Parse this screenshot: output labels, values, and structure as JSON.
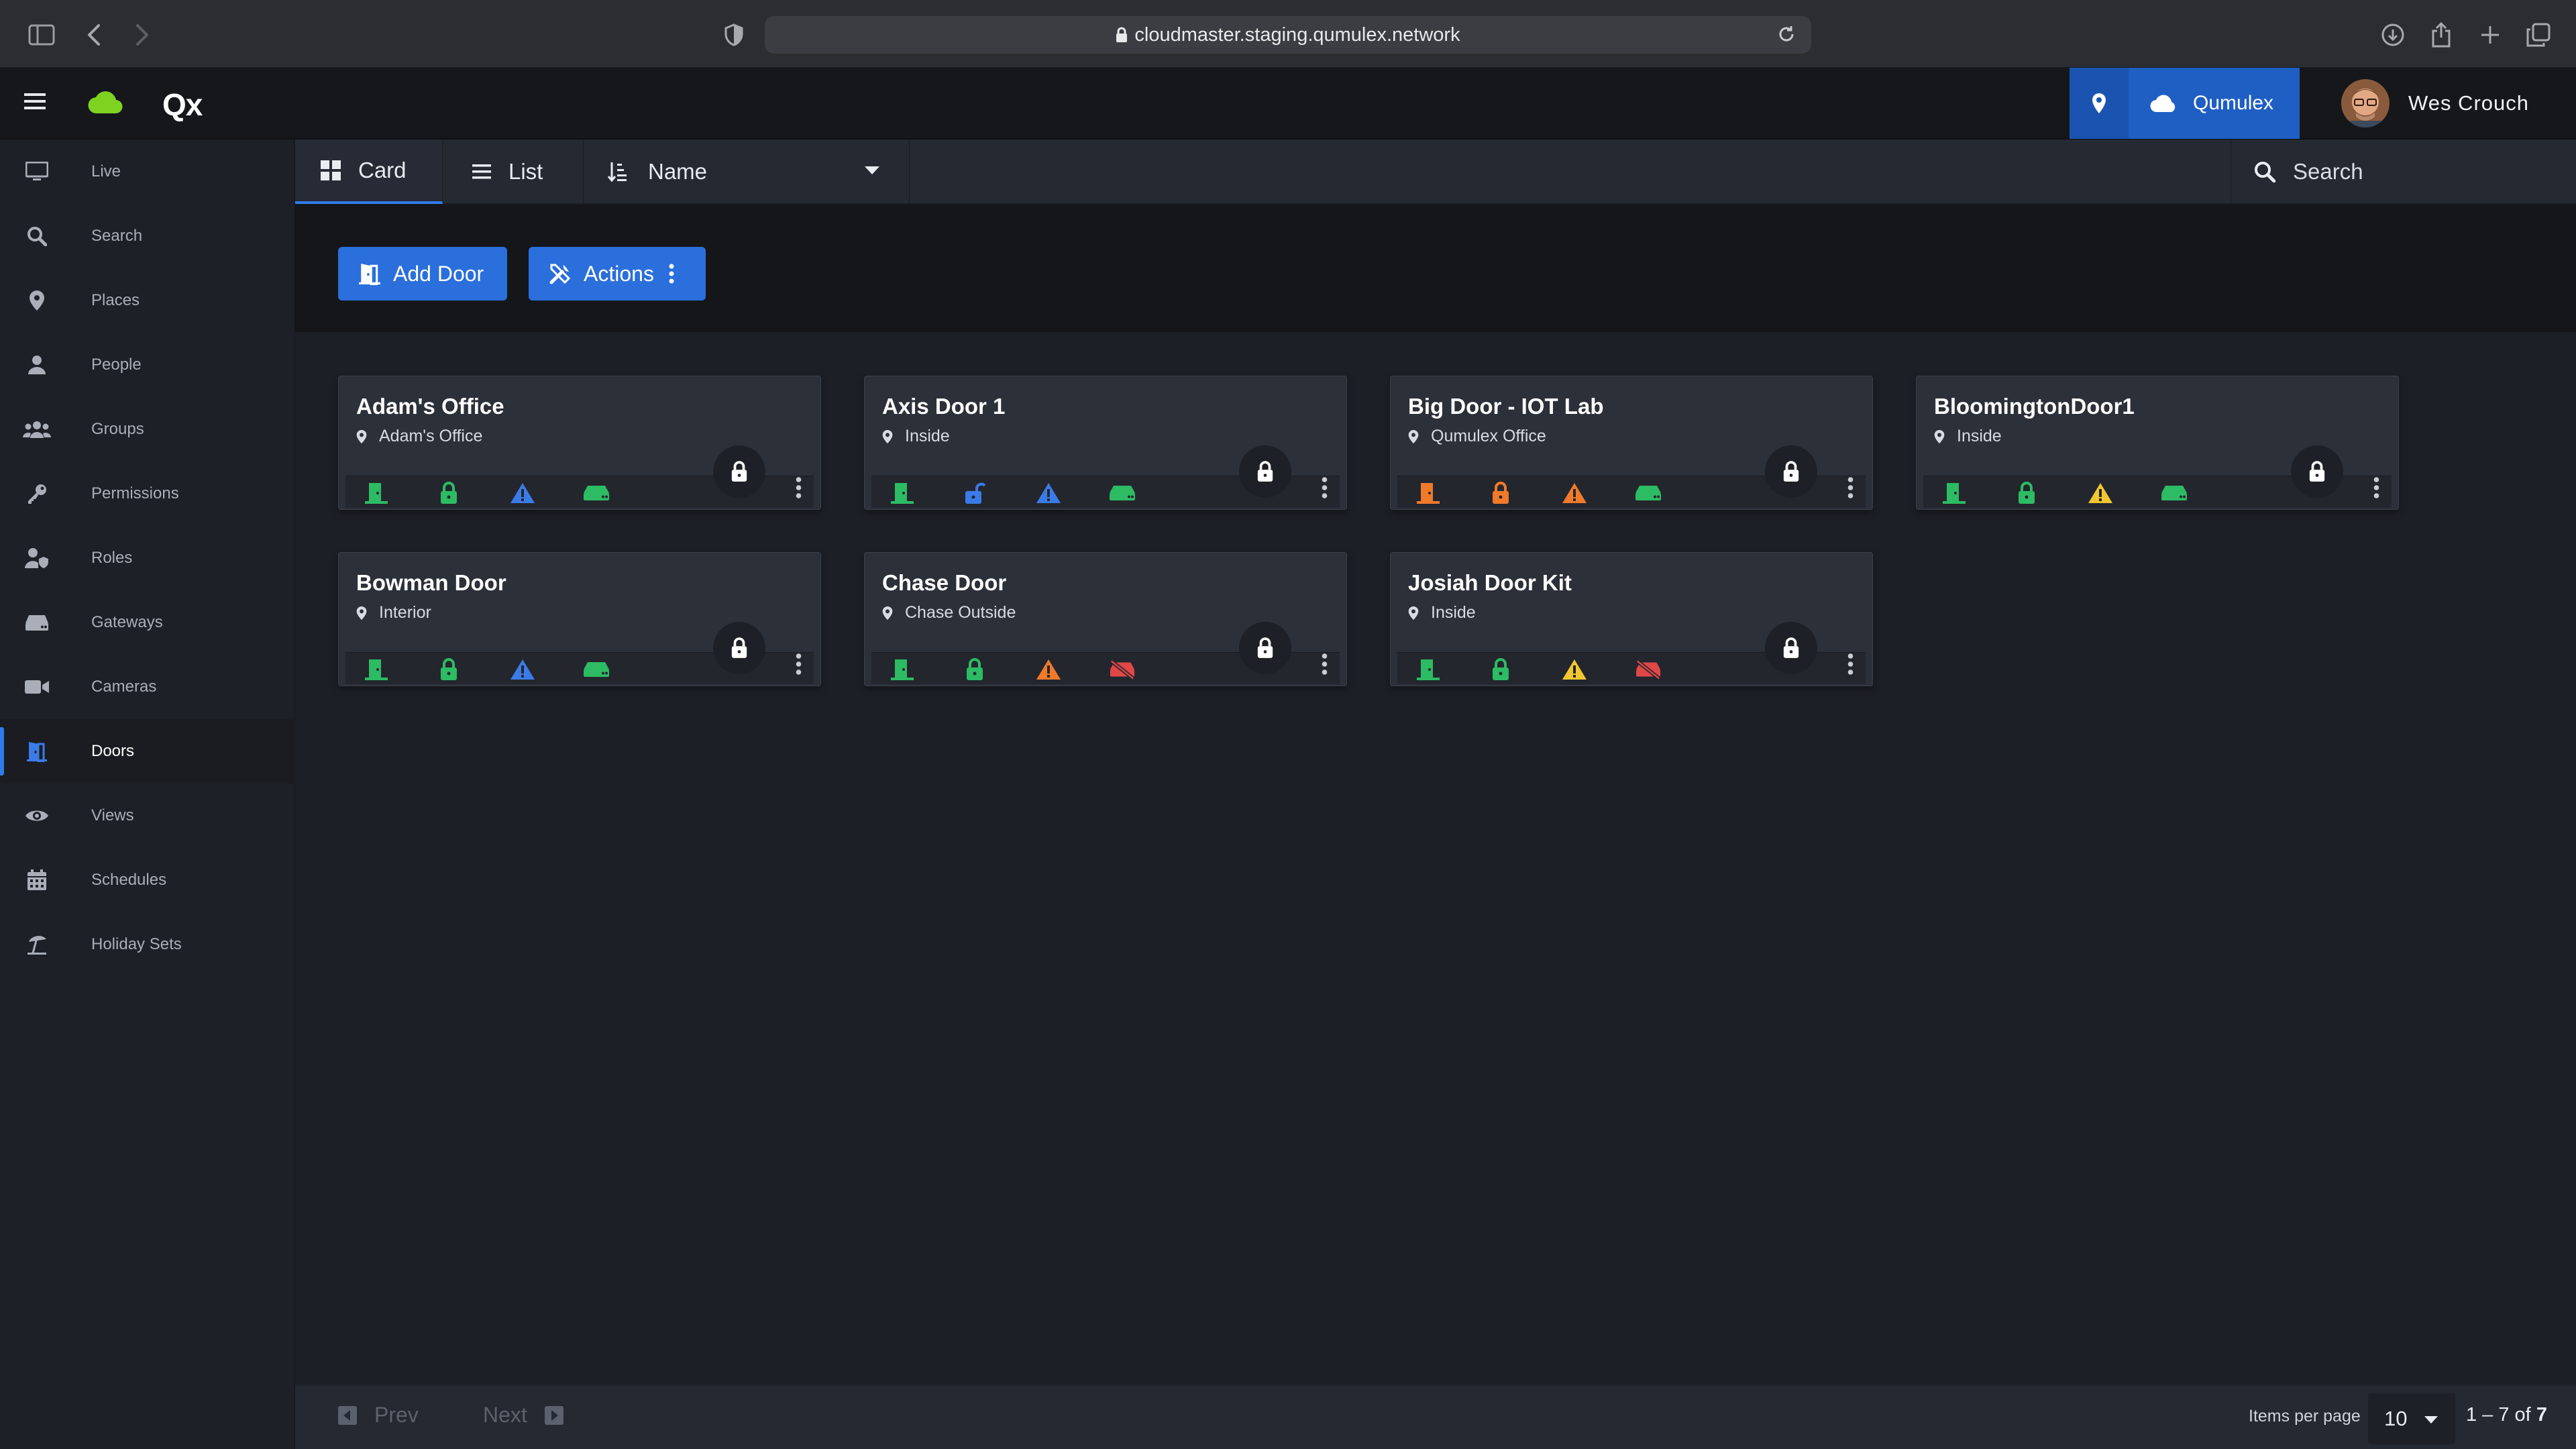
{
  "browser": {
    "url": "cloudmaster.staging.qumulex.network"
  },
  "header": {
    "brand": "Qx",
    "account_label": "Qumulex",
    "user_name": "Wes Crouch"
  },
  "colors": {
    "accent": "#2a6fdb",
    "ok": "#2dbb63",
    "info": "#3b7be8",
    "warn_orange": "#f07a2a",
    "warn_yellow": "#f2c631",
    "error": "#e24747"
  },
  "sidebar": {
    "items": [
      {
        "label": "Live",
        "icon": "monitor-icon"
      },
      {
        "label": "Search",
        "icon": "search-icon"
      },
      {
        "label": "Places",
        "icon": "map-pin-icon"
      },
      {
        "label": "People",
        "icon": "person-icon"
      },
      {
        "label": "Groups",
        "icon": "group-icon"
      },
      {
        "label": "Permissions",
        "icon": "key-icon"
      },
      {
        "label": "Roles",
        "icon": "user-shield-icon"
      },
      {
        "label": "Gateways",
        "icon": "server-icon"
      },
      {
        "label": "Cameras",
        "icon": "camera-icon"
      },
      {
        "label": "Doors",
        "icon": "door-icon",
        "active": true
      },
      {
        "label": "Views",
        "icon": "eye-icon"
      },
      {
        "label": "Schedules",
        "icon": "calendar-icon"
      },
      {
        "label": "Holiday Sets",
        "icon": "umbrella-beach-icon"
      }
    ]
  },
  "toolbar": {
    "card_label": "Card",
    "list_label": "List",
    "sort_label": "Name",
    "search_placeholder": "Search"
  },
  "actions": {
    "add_door_label": "Add Door",
    "actions_label": "Actions"
  },
  "doors": [
    {
      "name": "Adam's Office",
      "location": "Adam's Office",
      "statuses": [
        "door-green",
        "lock-green",
        "alert-blue",
        "hw-green"
      ]
    },
    {
      "name": "Axis Door 1",
      "location": "Inside",
      "statuses": [
        "door-green",
        "unlock-blue",
        "alert-blue",
        "hw-green"
      ]
    },
    {
      "name": "Big Door - IOT Lab",
      "location": "Qumulex Office",
      "statuses": [
        "door-orange",
        "lock-orange",
        "alert-orange",
        "hw-green"
      ]
    },
    {
      "name": "BloomingtonDoor1",
      "location": "Inside",
      "statuses": [
        "door-green",
        "lock-green",
        "alert-yellow",
        "hw-green"
      ]
    },
    {
      "name": "Bowman Door",
      "location": "Interior",
      "statuses": [
        "door-green",
        "lock-green",
        "alert-blue",
        "hw-green"
      ]
    },
    {
      "name": "Chase Door",
      "location": "Chase Outside",
      "statuses": [
        "door-green",
        "lock-green",
        "alert-orange",
        "hw-red-off"
      ]
    },
    {
      "name": "Josiah Door Kit",
      "location": "Inside",
      "statuses": [
        "door-green",
        "lock-green",
        "alert-yellow",
        "hw-red-off"
      ]
    }
  ],
  "pager": {
    "prev_label": "Prev",
    "next_label": "Next",
    "items_per_page_label": "Items per page",
    "items_per_page": "10",
    "range_text": "1 – 7 of ",
    "total": "7"
  }
}
